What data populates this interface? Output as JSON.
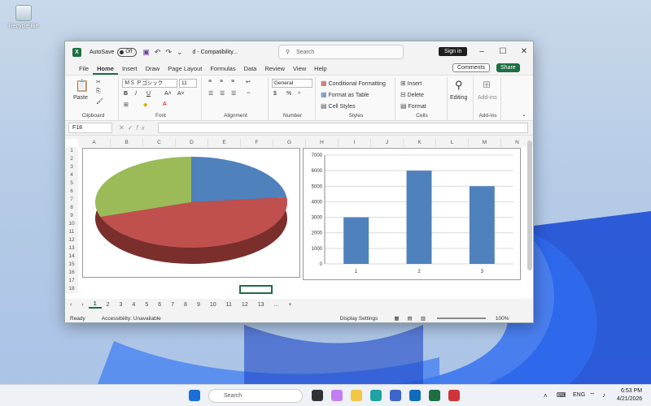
{
  "desktop": {
    "recycle_bin_label": "Recycle Bin"
  },
  "window": {
    "autosave_label": "AutoSave",
    "autosave_state": "Off",
    "doc_title": "d - Compatibility...",
    "search_placeholder": "Search",
    "signin_label": "Sign in",
    "tabs": [
      "File",
      "Home",
      "Insert",
      "Draw",
      "Page Layout",
      "Formulas",
      "Data",
      "Review",
      "View",
      "Help"
    ],
    "active_tab": "Home",
    "comments_label": "Comments",
    "share_label": "Share"
  },
  "ribbon": {
    "clipboard": {
      "label": "Clipboard",
      "paste": "Paste"
    },
    "font": {
      "label": "Font",
      "font_name": "ＭＳ Ｐゴシック",
      "font_size": "11"
    },
    "alignment": {
      "label": "Alignment"
    },
    "number": {
      "label": "Number",
      "format": "General"
    },
    "styles": {
      "label": "Styles",
      "conditional": "Conditional Formatting",
      "table": "Format as Table",
      "cell_styles": "Cell Styles"
    },
    "cells": {
      "label": "Cells",
      "insert": "Insert",
      "delete": "Delete",
      "format": "Format"
    },
    "editing": {
      "label": "Editing"
    },
    "addins": {
      "label": "Add-ins",
      "button": "Add-ins"
    }
  },
  "formula_bar": {
    "name_box": "F18",
    "fx": "fx",
    "value": ""
  },
  "grid": {
    "columns": [
      "A",
      "B",
      "C",
      "D",
      "E",
      "F",
      "G",
      "H",
      "I",
      "J",
      "K",
      "L",
      "M",
      "N"
    ],
    "rows": [
      "1",
      "2",
      "3",
      "4",
      "5",
      "6",
      "7",
      "8",
      "9",
      "10",
      "11",
      "12",
      "13",
      "14",
      "15",
      "16",
      "17",
      "18"
    ],
    "selected_cell": "F18"
  },
  "chart_data": [
    {
      "type": "pie",
      "slices": [
        {
          "label": "Blue",
          "value": 1,
          "color": "#4f81bd"
        },
        {
          "label": "Red",
          "value": 2,
          "color": "#c0504d"
        },
        {
          "label": "Green",
          "value": 1.3,
          "color": "#9bbb59"
        }
      ],
      "title": ""
    },
    {
      "type": "bar",
      "categories": [
        "1",
        "2",
        "3"
      ],
      "values": [
        3000,
        6000,
        5000
      ],
      "ylim": [
        0,
        7000
      ],
      "yticks": [
        "0",
        "1000",
        "2000",
        "3000",
        "4000",
        "5000",
        "6000",
        "7000"
      ],
      "color": "#4f81bd",
      "title": ""
    }
  ],
  "sheets": {
    "tabs": [
      "1",
      "2",
      "3",
      "4",
      "5",
      "6",
      "7",
      "8",
      "9",
      "10",
      "11",
      "12",
      "13"
    ],
    "active": "1",
    "more": "..."
  },
  "status": {
    "ready": "Ready",
    "accessibility": "Accessibility: Unavailable",
    "display_settings": "Display Settings",
    "zoom": "100%"
  },
  "taskbar": {
    "search": "Search",
    "lang": "ENG",
    "time": "6:53 PM",
    "date": "4/21/2026"
  }
}
